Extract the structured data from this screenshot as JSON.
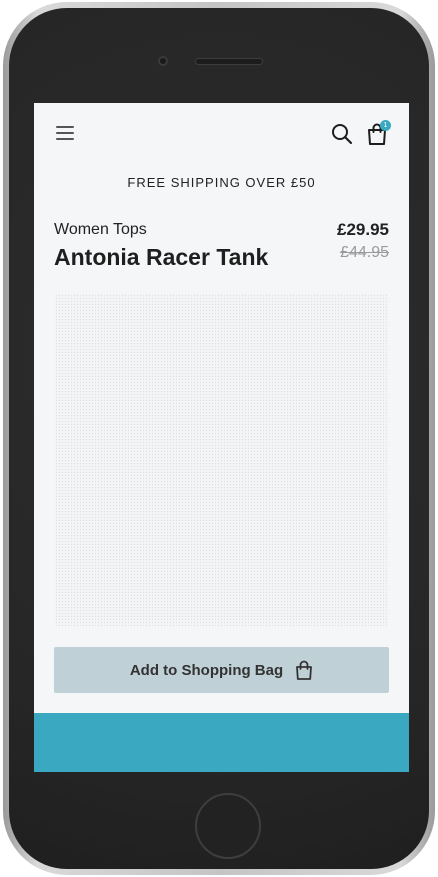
{
  "header": {
    "menu_icon": "hamburger-menu-icon",
    "search_icon": "search-icon",
    "bag_icon": "shopping-bag-icon",
    "bag_count": "1"
  },
  "banner": {
    "shipping_text": "FREE SHIPPING OVER £50"
  },
  "product": {
    "category": "Women Tops",
    "title": "Antonia Racer Tank",
    "price": "£29.95",
    "old_price": "£44.95"
  },
  "actions": {
    "add_to_bag_label": "Add to Shopping Bag"
  },
  "colors": {
    "accent": "#39a8c0",
    "button_bg": "#bfd1d7",
    "card_bg": "#f4f6f7"
  }
}
